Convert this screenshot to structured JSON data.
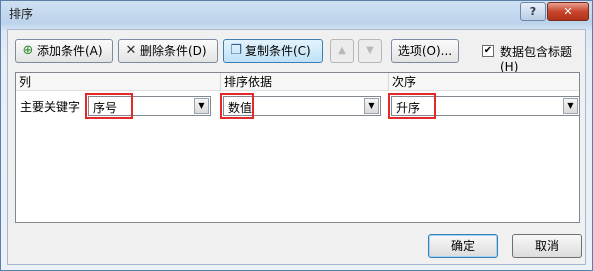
{
  "window": {
    "title": "排序",
    "help_label": "?",
    "close_label": "✕"
  },
  "toolbar": {
    "add_label": "添加条件(A)",
    "delete_label": "删除条件(D)",
    "copy_label": "复制条件(C)",
    "move_up_label": "▲",
    "move_down_label": "▼",
    "options_label": "选项(O)...",
    "has_headers_label": "数据包含标题(H)",
    "has_headers_checked": true
  },
  "grid": {
    "headers": {
      "column": "列",
      "sort_on": "排序依据",
      "order": "次序"
    },
    "rows": [
      {
        "label": "主要关键字",
        "column": "序号",
        "sort_on": "数值",
        "order": "升序"
      }
    ]
  },
  "footer": {
    "ok_label": "确定",
    "cancel_label": "取消"
  },
  "colors": {
    "highlight": "#e5282a",
    "title_bar": "#bcd3ec",
    "close_button": "#c7452c"
  }
}
